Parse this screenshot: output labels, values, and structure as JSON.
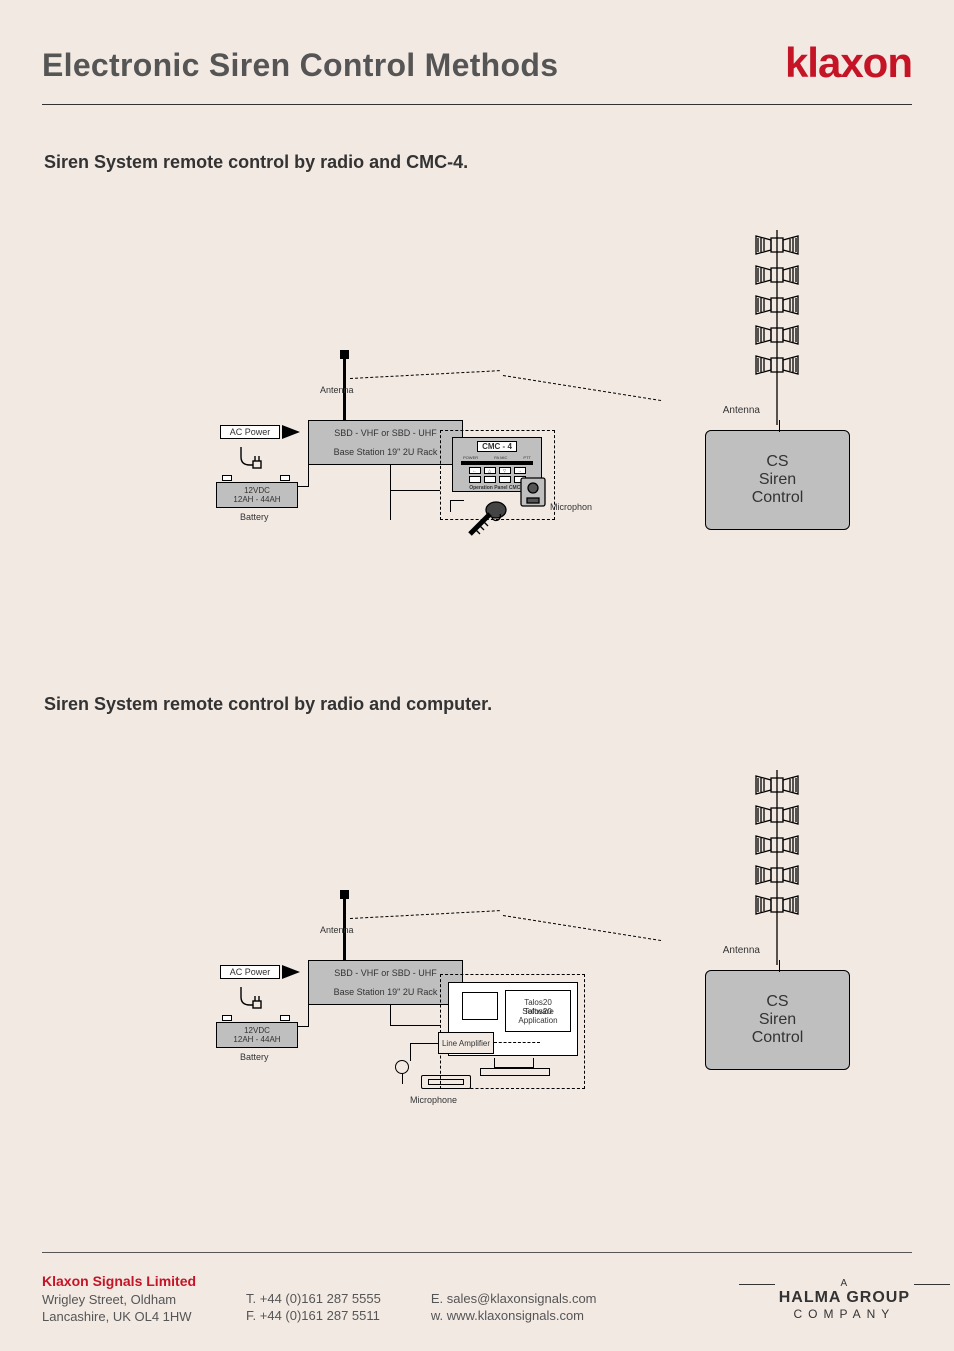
{
  "brand": "klaxon",
  "page_title": "Electronic Siren Control Methods",
  "brand_color": "#c41425",
  "sections": {
    "s1_heading": "Siren System remote control by radio and CMC-4.",
    "s2_heading": "Siren System remote control by radio and computer."
  },
  "diagram": {
    "antenna_label": "Antenna",
    "antenna2_label": "Antenna",
    "acpower": "AC Power",
    "base_line1": "SBD - VHF or SBD - UHF",
    "base_line2": "Base Station 19\" 2U Rack",
    "battery_line1": "12VDC",
    "battery_line2": "12AH - 44AH",
    "battery_caption": "Battery",
    "siren_l1": "CS",
    "siren_l2": "Siren",
    "siren_l3": "Control",
    "micro1": "Microphon",
    "micro2": "Microphone",
    "cmc_title": "CMC - 4",
    "cmc_leds": {
      "a": "POWER",
      "b": "PA MIC",
      "c": "PTT"
    },
    "cmc_caption": "Operation Panel CMC-4",
    "talos_l1": "Talos20",
    "talos_l2": "Software",
    "talos_l3": "Application",
    "line_amp": "Line Amplifier"
  },
  "footer": {
    "company": "Klaxon Signals Limited",
    "addr1": "Wrigley Street, Oldham",
    "addr2": "Lancashire, UK OL4 1HW",
    "tel": "T. +44 (0)161 287 5555",
    "fax": "F. +44 (0)161 287 5511",
    "email": "E. sales@klaxonsignals.com",
    "web": "w. www.klaxonsignals.com",
    "halma_top": "A",
    "halma_main": "HALMA GROUP",
    "halma_sub": "COMPANY"
  }
}
